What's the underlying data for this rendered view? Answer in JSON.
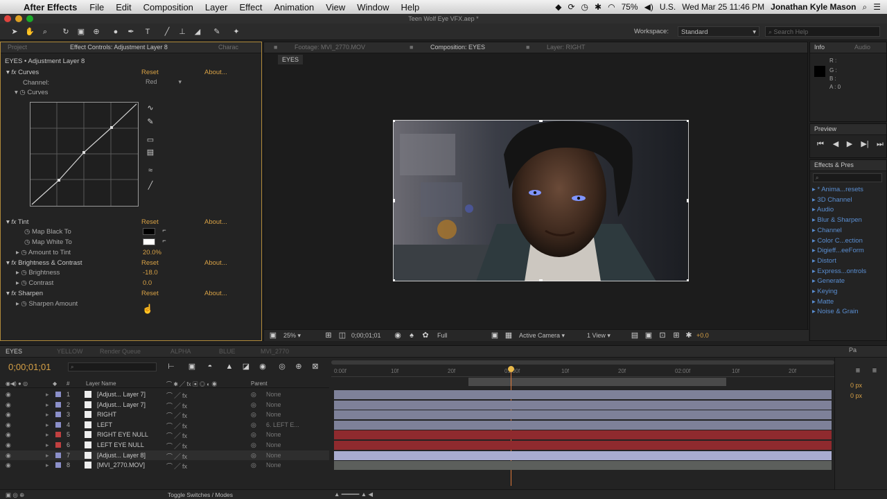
{
  "menubar": {
    "app_name": "After Effects",
    "menus": [
      "File",
      "Edit",
      "Composition",
      "Layer",
      "Effect",
      "Animation",
      "View",
      "Window",
      "Help"
    ],
    "battery": "75%",
    "locale": "U.S.",
    "datetime": "Wed Mar 25  11:46 PM",
    "user": "Jonathan Kyle Mason"
  },
  "window": {
    "title": "Teen Wolf Eye VFX.aep *"
  },
  "toolbar": {
    "workspace_label": "Workspace:",
    "workspace_value": "Standard",
    "search_placeholder": "Search Help"
  },
  "effect_controls": {
    "tabs": [
      "Project",
      "Effect Controls: Adjustment Layer 8",
      "Charac"
    ],
    "breadcrumb": "EYES • Adjustment Layer 8",
    "curves": {
      "name": "Curves",
      "reset": "Reset",
      "about": "About...",
      "channel_label": "Channel:",
      "channel_value": "Red",
      "sub_label": "Curves"
    },
    "tint": {
      "name": "Tint",
      "reset": "Reset",
      "about": "About...",
      "map_black": "Map Black To",
      "map_white": "Map White To",
      "amount_label": "Amount to Tint",
      "amount_value": "20.0%"
    },
    "brightness": {
      "name": "Brightness & Contrast",
      "reset": "Reset",
      "about": "About...",
      "brightness_label": "Brightness",
      "brightness_value": "-18.0",
      "contrast_label": "Contrast",
      "contrast_value": "0.0"
    },
    "sharpen": {
      "name": "Sharpen",
      "reset": "Reset",
      "about": "About...",
      "amount_label": "Sharpen Amount"
    }
  },
  "viewer": {
    "tabs": [
      "Footage: MVI_2770.MOV",
      "Composition: EYES",
      "Layer: RIGHT"
    ],
    "comp_name": "EYES",
    "zoom": "25%",
    "timecode": "0;00;01;01",
    "resolution": "Full",
    "camera": "Active Camera",
    "views": "1 View",
    "exposure": "+0.0"
  },
  "info_panel": {
    "tabs": [
      "Info",
      "Audio"
    ],
    "r": "R :",
    "g": "G :",
    "b": "B :",
    "a": "A : 0"
  },
  "preview_panel": {
    "title": "Preview"
  },
  "effects_presets": {
    "title": "Effects & Pres",
    "items": [
      "* Anima...resets",
      "3D Channel",
      "Audio",
      "Blur & Sharpen",
      "Channel",
      "Color C...ection",
      "Digieff...eeForm",
      "Distort",
      "Express...ontrols",
      "Generate",
      "Keying",
      "Matte",
      "Noise & Grain"
    ]
  },
  "timeline": {
    "tabs": [
      "EYES",
      "YELLOW",
      "Render Queue",
      "ALPHA",
      "BLUE",
      "MVI_2770"
    ],
    "timecode": "0;00;01;01",
    "col_layer_name": "Layer Name",
    "col_parent": "Parent",
    "ruler_ticks": [
      "0:00f",
      "10f",
      "20f",
      "01:00f",
      "10f",
      "20f",
      "02:00f",
      "10f",
      "20f"
    ],
    "toggle_label": "Toggle Switches / Modes",
    "layers": [
      {
        "num": "1",
        "name": "[Adjust... Layer 7]",
        "parent": "None",
        "color": "#8b8fc9",
        "bar": "#7e8199"
      },
      {
        "num": "2",
        "name": "[Adjust... Layer 7]",
        "parent": "None",
        "color": "#8b8fc9",
        "bar": "#7e8199"
      },
      {
        "num": "3",
        "name": "RIGHT",
        "parent": "None",
        "color": "#8b8fc9",
        "bar": "#7e8199"
      },
      {
        "num": "4",
        "name": "LEFT",
        "parent": "6. LEFT E...",
        "color": "#8b8fc9",
        "bar": "#7e8199"
      },
      {
        "num": "5",
        "name": "RIGHT EYE NULL",
        "parent": "None",
        "color": "#c04040",
        "bar": "#8f2a2e"
      },
      {
        "num": "6",
        "name": "LEFT EYE NULL",
        "parent": "None",
        "color": "#c04040",
        "bar": "#8f2a2e"
      },
      {
        "num": "7",
        "name": "[Adjust... Layer 8]",
        "parent": "None",
        "color": "#8b8fc9",
        "bar": "#a9acd0"
      },
      {
        "num": "8",
        "name": "[MVI_2770.MOV]",
        "parent": "None",
        "color": "#8b8fc9",
        "bar": "#5c5f5c"
      }
    ],
    "right_values": [
      "0 px",
      "0 px"
    ]
  },
  "colors": {
    "accent_orange": "#d7a146",
    "link_blue": "#4d8fd6",
    "playhead": "#e07a3a"
  }
}
